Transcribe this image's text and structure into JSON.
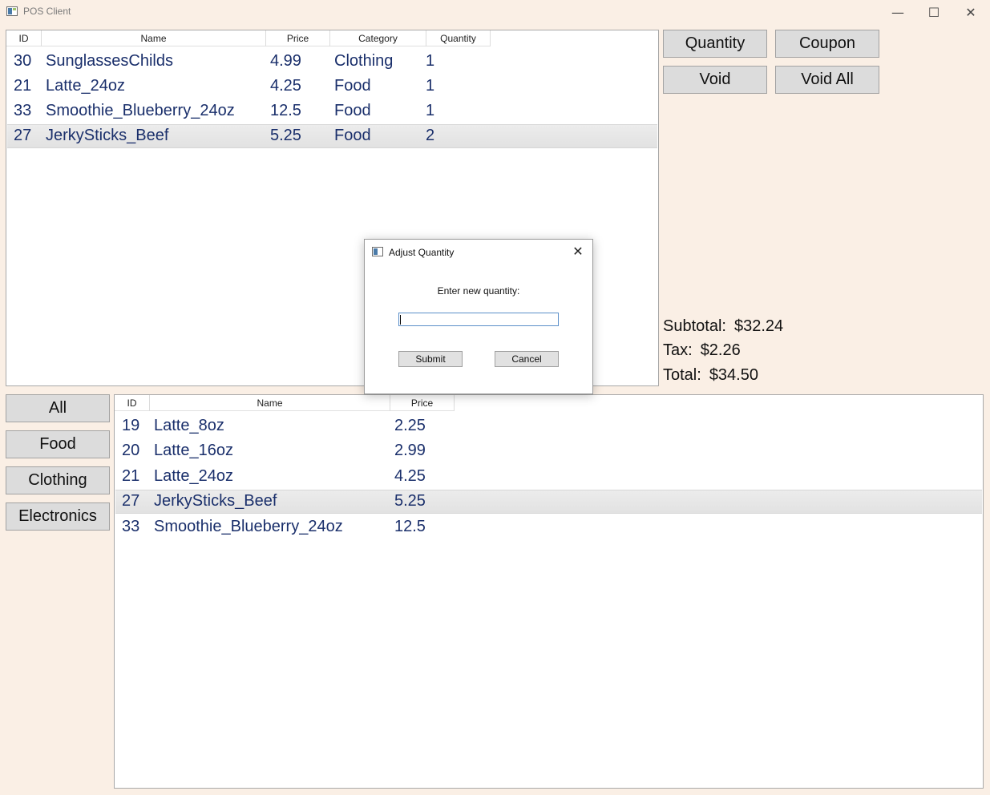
{
  "window": {
    "title": "POS Client",
    "minimize_glyph": "—",
    "maximize_glyph": "☐",
    "close_glyph": "✕"
  },
  "cart": {
    "columns": [
      "ID",
      "Name",
      "Price",
      "Category",
      "Quantity"
    ],
    "rows": [
      {
        "id": "30",
        "name": "SunglassesChilds",
        "price": "4.99",
        "category": "Clothing",
        "quantity": "1"
      },
      {
        "id": "21",
        "name": "Latte_24oz",
        "price": "4.25",
        "category": "Food",
        "quantity": "1"
      },
      {
        "id": "33",
        "name": "Smoothie_Blueberry_24oz",
        "price": "12.5",
        "category": "Food",
        "quantity": "1"
      },
      {
        "id": "27",
        "name": "JerkySticks_Beef",
        "price": "5.25",
        "category": "Food",
        "quantity": "2"
      }
    ],
    "selected_index": 3
  },
  "actions": {
    "quantity": "Quantity",
    "coupon": "Coupon",
    "void": "Void",
    "void_all": "Void All"
  },
  "totals": {
    "subtotal_label": "Subtotal:",
    "subtotal_value": "$32.24",
    "tax_label": "Tax:",
    "tax_value": "$2.26",
    "total_label": "Total:",
    "total_value": "$34.50"
  },
  "categories": {
    "all": "All",
    "food": "Food",
    "clothing": "Clothing",
    "electronics": "Electronics"
  },
  "products": {
    "columns": [
      "ID",
      "Name",
      "Price"
    ],
    "rows": [
      {
        "id": "19",
        "name": "Latte_8oz",
        "price": "2.25"
      },
      {
        "id": "20",
        "name": "Latte_16oz",
        "price": "2.99"
      },
      {
        "id": "21",
        "name": "Latte_24oz",
        "price": "4.25"
      },
      {
        "id": "27",
        "name": "JerkySticks_Beef",
        "price": "5.25"
      },
      {
        "id": "33",
        "name": "Smoothie_Blueberry_24oz",
        "price": "12.5"
      }
    ],
    "selected_index": 3
  },
  "dialog": {
    "title": "Adjust Quantity",
    "close_glyph": "✕",
    "prompt": "Enter new quantity:",
    "input_value": "",
    "submit": "Submit",
    "cancel": "Cancel"
  },
  "colors": {
    "background": "#faefe5",
    "row_text": "#1a2f6b",
    "button_face": "#dcdcdc"
  }
}
